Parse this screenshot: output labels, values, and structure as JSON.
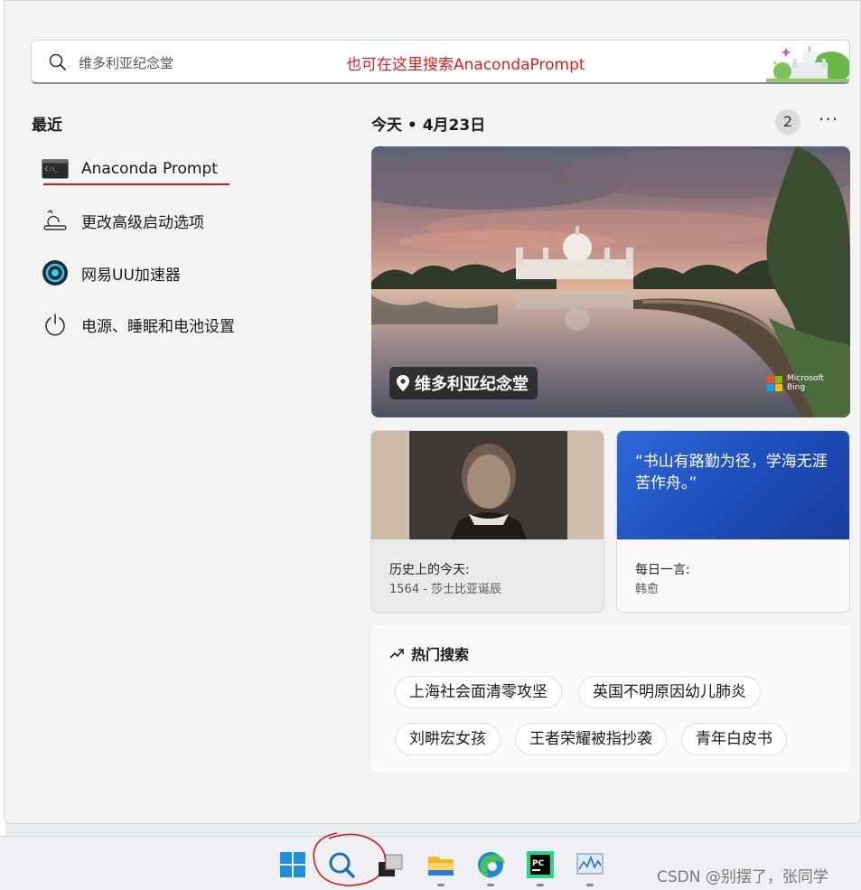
{
  "search": {
    "placeholder": "维多利亚纪念堂",
    "annotation": "也可在这里搜索AnacondaPrompt"
  },
  "recent": {
    "title": "最近",
    "items": [
      {
        "label": "Anaconda Prompt",
        "icon": "terminal-icon"
      },
      {
        "label": "更改高级启动选项",
        "icon": "advanced-startup-icon"
      },
      {
        "label": "网易UU加速器",
        "icon": "uu-accelerator-icon"
      },
      {
        "label": "电源、睡眠和电池设置",
        "icon": "power-icon"
      }
    ]
  },
  "today": {
    "title": "今天 • 4月23日",
    "badge_count": "2",
    "more": "···"
  },
  "hero": {
    "caption": "维多利亚纪念堂",
    "brand_line1": "Microsoft",
    "brand_line2": "Bing"
  },
  "cards": {
    "history": {
      "title": "历史上的今天:",
      "sub": "1564 - 莎士比亚诞辰"
    },
    "quote": {
      "text": "“书山有路勤为径，学海无涯苦作舟。”",
      "title": "每日一言:",
      "sub": "韩愈"
    }
  },
  "hot": {
    "title": "热门搜索",
    "chips": [
      "上海社会面清零攻坚",
      "英国不明原因幼儿肺炎",
      "刘畊宏女孩",
      "王者荣耀被指抄袭",
      "青年白皮书"
    ]
  },
  "taskbar": {
    "items": [
      "windows-start-icon",
      "search-icon",
      "task-view-icon",
      "file-explorer-icon",
      "edge-icon",
      "pycharm-icon",
      "resource-monitor-icon"
    ],
    "watermark": "CSDN @别摆了，张同学"
  },
  "colors": {
    "annotation_red": "#e0201c",
    "accent_blue": "#2f68d8"
  }
}
